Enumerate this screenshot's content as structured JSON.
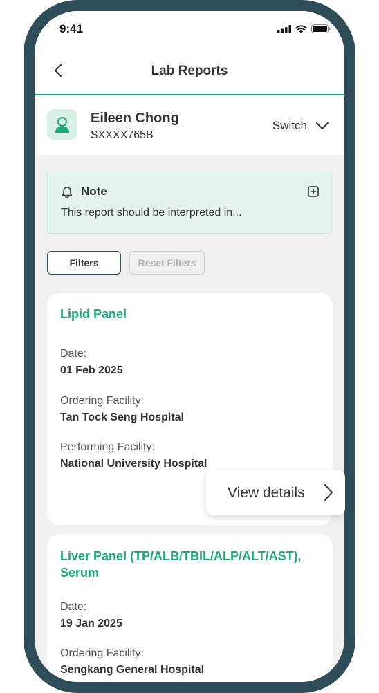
{
  "status_bar": {
    "time": "9:41"
  },
  "nav": {
    "title": "Lab Reports"
  },
  "profile": {
    "name": "Eileen Chong",
    "id": "SXXXX765B",
    "switch_label": "Switch"
  },
  "note": {
    "title": "Note",
    "text": "This report should be interpreted in..."
  },
  "filters": {
    "filters_label": "Filters",
    "reset_label": "Reset Filters"
  },
  "reports": [
    {
      "title": "Lipid Panel",
      "date_label": "Date:",
      "date": "01 Feb 2025",
      "ordering_label": "Ordering Facility:",
      "ordering": "Tan Tock Seng Hospital",
      "performing_label": "Performing Facility:",
      "performing": "National University Hospital"
    },
    {
      "title_line1": "Liver Panel (TP/ALB/TBIL/ALP/ALT/AST),",
      "title_line2": "Serum",
      "date_label": "Date:",
      "date": "19 Jan 2025",
      "ordering_label": "Ordering Facility:",
      "ordering": "Sengkang General Hospital"
    }
  ],
  "view_details": {
    "label": "View details"
  },
  "colors": {
    "accent": "#1aa97a",
    "frame": "#2f4d58",
    "note_bg": "#e4f3ee",
    "background": "#f0f0f0"
  }
}
